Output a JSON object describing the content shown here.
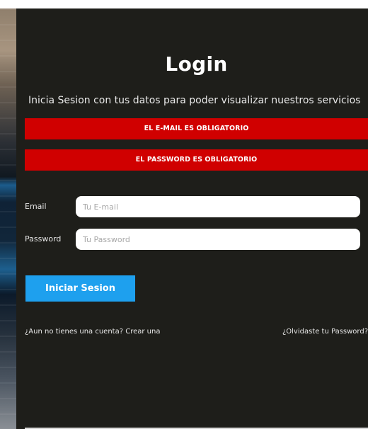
{
  "form": {
    "title": "Login",
    "subtitle": "Inicia Sesion con tus datos para poder visualizar nuestros servicios",
    "alerts": [
      "EL E-MAIL ES OBLIGATORIO",
      "EL PASSWORD ES OBLIGATORIO"
    ],
    "email": {
      "label": "Email",
      "placeholder": "Tu E-mail",
      "value": ""
    },
    "password": {
      "label": "Password",
      "placeholder": "Tu Password",
      "value": ""
    },
    "submit_label": "Iniciar Sesion",
    "create_account_link": "¿Aun no tienes una cuenta? Crear una",
    "forgot_password_link": "¿Olvidaste tu Password?"
  },
  "colors": {
    "panel_background": "#1e1e1a",
    "alert": "#d00000",
    "button": "#1ea0ee"
  }
}
